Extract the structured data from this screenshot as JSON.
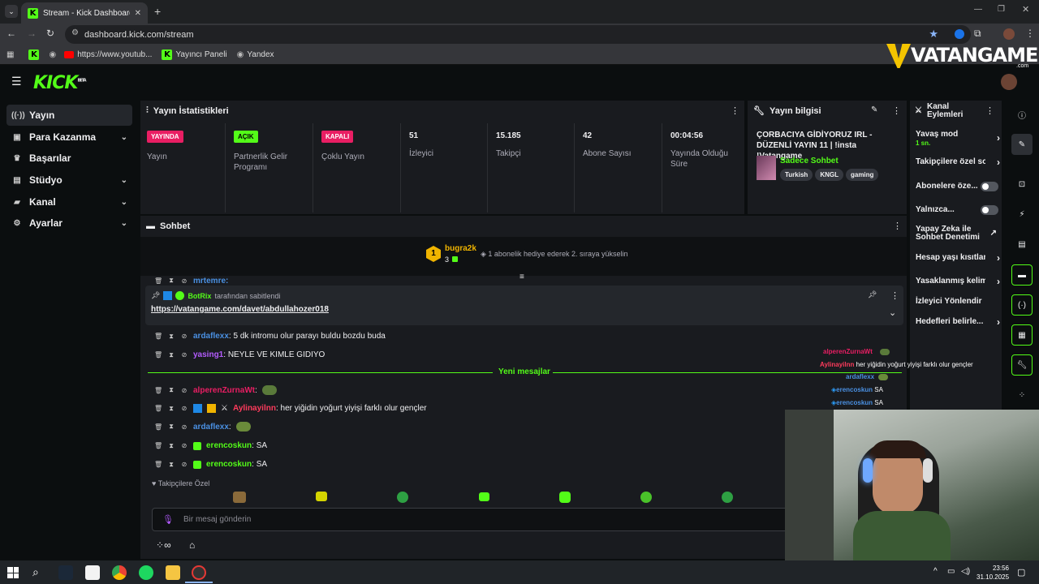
{
  "browser": {
    "tab_title": "Stream - Kick Dashboard",
    "url": "dashboard.kick.com/stream",
    "bookmarks": [
      "https://www.youtub...",
      "Yayıncı Paneli",
      "Yandex"
    ]
  },
  "app": {
    "logo": "KICK",
    "logo_sup": "BETA"
  },
  "watermark": {
    "text": "VATANGAME",
    "suffix": ".com"
  },
  "sidebar": {
    "items": [
      {
        "label": "Yayın",
        "icon": "broadcast-icon"
      },
      {
        "label": "Para Kazanma",
        "icon": "money-icon"
      },
      {
        "label": "Başarılar",
        "icon": "trophy-icon"
      },
      {
        "label": "Stüdyo",
        "icon": "studio-icon"
      },
      {
        "label": "Kanal",
        "icon": "channel-icon"
      },
      {
        "label": "Ayarlar",
        "icon": "settings-icon"
      }
    ]
  },
  "stats": {
    "title": "Yayın İstatistikleri",
    "columns": [
      {
        "badge": "YAYINDA",
        "label": "Yayın",
        "badge_color": "#e91e63"
      },
      {
        "badge": "AÇIK",
        "label": "Partnerlik Gelir Programı",
        "badge_color": "#53fc18"
      },
      {
        "badge": "KAPALI",
        "label": "Çoklu Yayın",
        "badge_color": "#e91e63"
      },
      {
        "value": "51",
        "label": "İzleyici"
      },
      {
        "value": "15.185",
        "label": "Takipçi"
      },
      {
        "value": "42",
        "label": "Abone Sayısı"
      },
      {
        "value": "00:04:56",
        "label": "Yayında Olduğu Süre"
      }
    ]
  },
  "stream_info": {
    "title": "Yayın bilgisi",
    "stream_title": "ÇORBACIYA GİDİYORUZ IRL - DÜZENLİ YAYIN 11 | !insta !Vatangame",
    "category": "Sadece Sohbet",
    "tags": [
      "Turkish",
      "KNGL",
      "gaming"
    ]
  },
  "channel_actions": {
    "title": "Kanal Eylemleri",
    "items": [
      {
        "label": "Yavaş mod",
        "sub": "1 sn.",
        "control": "chevron"
      },
      {
        "label": "Takipçilere özel so",
        "control": "chevron"
      },
      {
        "label": "Abonelere öze...",
        "control": "toggle"
      },
      {
        "label": "Yalnızca...",
        "control": "toggle"
      },
      {
        "label": "Yapay Zeka ile Sohbet Denetimi",
        "control": "external"
      },
      {
        "label": "Hesap yaşı kısıtlan",
        "control": "chevron"
      },
      {
        "label": "Yasaklanmış kelim",
        "control": "chevron"
      },
      {
        "label": "İzleyici Yönlendir",
        "control": "none"
      },
      {
        "label": "Hedefleri belirle...",
        "control": "chevron"
      }
    ]
  },
  "chat": {
    "title": "Sohbet",
    "leader": {
      "rank": "1",
      "name": "bugra2k",
      "count": "3",
      "hint": "1 abonelik hediye ederek 2. sıraya yükselin"
    },
    "partial_user": "mrtemre:",
    "pinned": {
      "by": "BotRix",
      "by_suffix": "tarafından sabitlendi",
      "link": "https://vatangame.com/davet/abdullahozer018"
    },
    "new_messages": "Yeni mesajlar",
    "messages": [
      {
        "user": "ardaflexx",
        "color": "#4a90e2",
        "text": "5 dk intromu olur parayı buldu bozdu buda"
      },
      {
        "user": "yasing1",
        "color": "#b45cff",
        "text": "NEYLE VE KIMLE GIDIYO"
      },
      {
        "user": "alperenZurnaWt",
        "color": "#e91e63",
        "text": ""
      },
      {
        "user": "Aylinayilnn",
        "color": "#ff3b5c",
        "text": "her yiğidin yoğurt yiyişi farklı olur gençler"
      },
      {
        "user": "ardaflexx",
        "color": "#4a90e2",
        "text": ""
      },
      {
        "user": "erencoskun",
        "color": "#53fc18",
        "text": "SA"
      },
      {
        "user": "erencoskun",
        "color": "#53fc18",
        "text": "SA"
      }
    ],
    "followers_only": "Takipçilere Özel",
    "input_placeholder": "Bir mesaj gönderin",
    "infinity": "∞"
  },
  "overlay_chat": [
    {
      "user": "alperenZurnaWt",
      "text": ""
    },
    {
      "user": "Aylinayilnn",
      "text": "her yiğidin yoğurt yiyişi farklı olur gençler"
    },
    {
      "user": "ardaflexx",
      "text": ""
    },
    {
      "user": "erencoskun",
      "text": "SA"
    },
    {
      "user": "erencoskun",
      "text": "SA"
    }
  ],
  "taskbar": {
    "time": "23:56",
    "date": "31.10.2025"
  }
}
